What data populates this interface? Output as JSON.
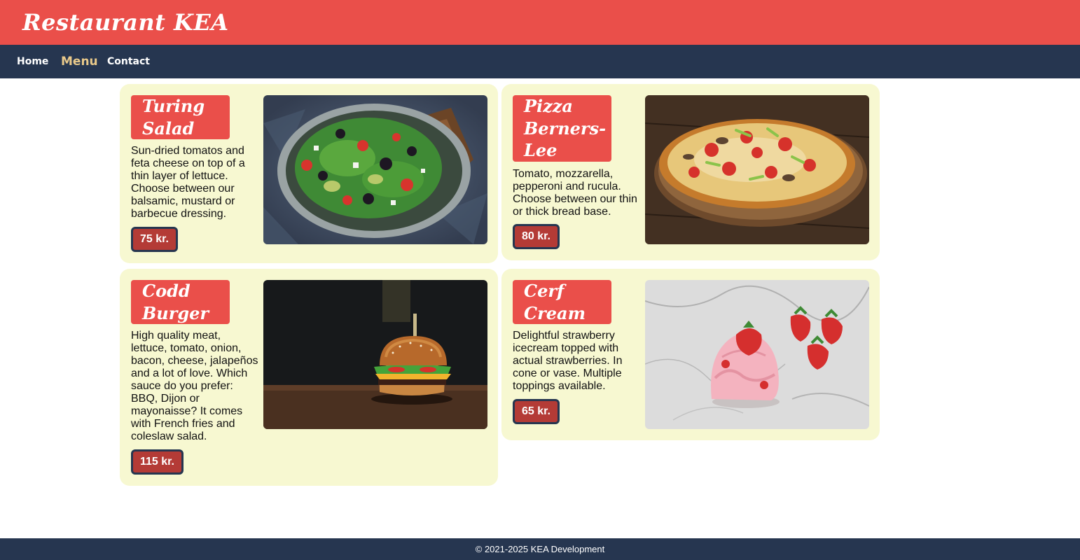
{
  "header": {
    "title": "Restaurant KEA"
  },
  "nav": {
    "home": "Home",
    "menu": "Menu",
    "contact": "Contact",
    "active": "Menu"
  },
  "menu": [
    {
      "title": "Turing Salad",
      "description": "Sun-dried tomatos and feta cheese on top of a thin layer of lettuce. Choose between our balsamic, mustard or barbecue dressing.",
      "price": "75 kr.",
      "image": "salad-bowl-photo"
    },
    {
      "title": "Pizza Berners-Lee",
      "description": "Tomato, mozzarella, pepperoni and rucula. Choose between our thin or thick bread base.",
      "price": "80 kr.",
      "image": "pizza-photo"
    },
    {
      "title": "Codd Burger",
      "description": "High quality meat, lettuce, tomato, onion, bacon, cheese, jalapeños and a lot of love. Which sauce do you prefer: BBQ, Dijon or mayonaisse? It comes with French fries and coleslaw salad.",
      "price": "115 kr.",
      "image": "burger-photo"
    },
    {
      "title": "Cerf Cream",
      "description": "Delightful strawberry icecream topped with actual strawberries. In cone or vase. Multiple toppings available.",
      "price": "65 kr.",
      "image": "strawberry-icecream-photo"
    }
  ],
  "footer": {
    "text": "© 2021-2025 KEA Development"
  },
  "colors": {
    "header_bg": "#ea4f4a",
    "nav_bg": "#263650",
    "nav_active": "#e9c98a",
    "card_bg": "#f7f8d1",
    "title_bg": "#ea4f4a",
    "price_bg": "#b43b36",
    "price_border": "#263650"
  }
}
